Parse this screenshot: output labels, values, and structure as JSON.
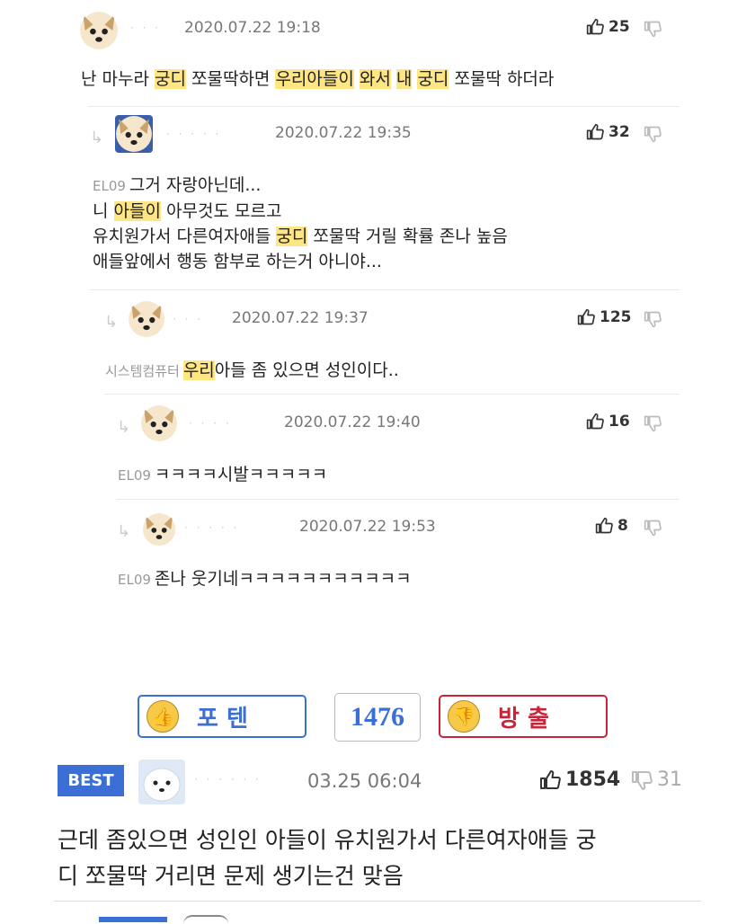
{
  "comments": [
    {
      "date": "2020.07.22 19:18",
      "likes": "25",
      "segments": [
        {
          "t": "난 마누라 ",
          "h": false
        },
        {
          "t": "궁디",
          "h": true
        },
        {
          "t": " 쪼물딱하면 ",
          "h": false
        },
        {
          "t": "우리아들이",
          "h": true
        },
        {
          "t": " ",
          "h": false
        },
        {
          "t": "와서",
          "h": true
        },
        {
          "t": " ",
          "h": false
        },
        {
          "t": "내",
          "h": true
        },
        {
          "t": " ",
          "h": false
        },
        {
          "t": "궁디",
          "h": true
        },
        {
          "t": " 쪼물딱 하더라",
          "h": false
        }
      ]
    },
    {
      "date": "2020.07.22 19:35",
      "likes": "32",
      "prefix": "EL09",
      "lines": [
        [
          {
            "t": "그거 자랑아닌데...",
            "h": false
          }
        ],
        [
          {
            "t": "니 ",
            "h": false
          },
          {
            "t": "아들이",
            "h": true
          },
          {
            "t": " 아무것도 모르고",
            "h": false
          }
        ],
        [
          {
            "t": "유치원가서 다른여자애들 ",
            "h": false
          },
          {
            "t": "궁디",
            "h": true
          },
          {
            "t": " 쪼물딱 거릴 확률 존나 높음",
            "h": false
          }
        ],
        [
          {
            "t": "애들앞에서 행동 함부로 하는거 아니야...",
            "h": false
          }
        ]
      ]
    },
    {
      "date": "2020.07.22 19:37",
      "likes": "125",
      "prefix": "시스템컴퓨터",
      "segments": [
        {
          "t": "우리",
          "h": true
        },
        {
          "t": "아들 좀 있으면 성인이다..",
          "h": false
        }
      ]
    },
    {
      "date": "2020.07.22 19:40",
      "likes": "16",
      "prefix": "EL09",
      "text": "ㅋㅋㅋㅋ시발ㅋㅋㅋㅋㅋ"
    },
    {
      "date": "2020.07.22 19:53",
      "likes": "8",
      "prefix": "EL09",
      "text": "존나 웃기네ㅋㅋㅋㅋㅋㅋㅋㅋㅋㅋㅋ"
    }
  ],
  "vote": {
    "up_label": "포 텐",
    "count": "1476",
    "down_label": "방 출"
  },
  "best": {
    "badge": "BEST",
    "date": "03.25 06:04",
    "likes": "1854",
    "dislikes": "31",
    "line1": "근데 좀있으면 성인인 아들이 유치원가서 다른여자애들 궁",
    "line2": "디 쪼물딱 거리면 문제 생기는건 맞음"
  },
  "icons": {
    "thumb_up": "thumb-up-icon",
    "thumb_down": "thumb-down-icon",
    "reply": "reply-arrow-icon"
  },
  "colors": {
    "highlight": "#fde683",
    "up_border": "#3b6fd6",
    "down_border": "#c8243a",
    "best_badge": "#3b6fd6"
  }
}
